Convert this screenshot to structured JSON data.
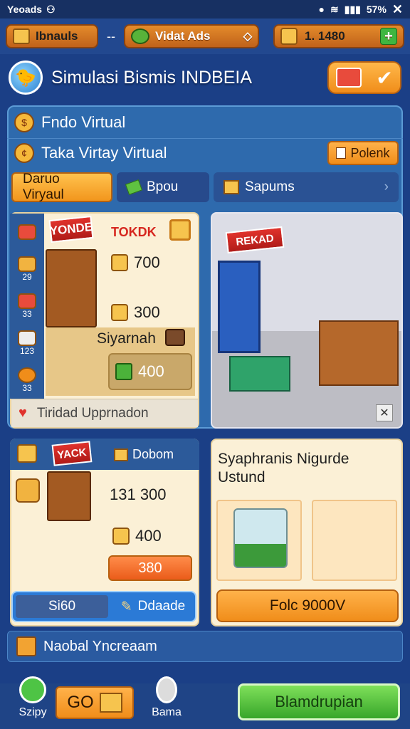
{
  "status": {
    "left_text": "Yeoads",
    "battery": "57%"
  },
  "resources": {
    "item1": "Ibnauls",
    "separator": "--",
    "item2": "Vidat Ads",
    "item3": "1. 1480"
  },
  "header": {
    "title": "Simulasi Bismis INDBEIA"
  },
  "panel": {
    "row1": "Fndo Virtual",
    "row2": "Taka Virtay Virtual",
    "row2_button": "Polenk",
    "tabs": [
      "Daruo Viryaul",
      "Bpou",
      "Sapums"
    ]
  },
  "shop_card": {
    "sign": "YONDE",
    "brand": "TOKDK",
    "value1": "700",
    "value2": "300",
    "subtitle": "Siyarnah",
    "value3": "400",
    "sidebar_counts": [
      "29",
      "33",
      "123",
      "33"
    ],
    "footer": "Tiridad Upprnadon"
  },
  "scene": {
    "banner": "REKAD"
  },
  "store_card": {
    "tag": "YACK",
    "header": "Dobom",
    "value1": "131 300",
    "value2": "400",
    "orange_value": "380",
    "left_button": "Si60",
    "right_button": "Ddaade"
  },
  "upgrade_card": {
    "title": "Syaphranis Nigurde Ustund",
    "button": "Folc 9000V"
  },
  "info_bar": {
    "text": "Naobal Yncreaam"
  },
  "bottom": {
    "nav1": "Szipy",
    "nav2": "GO",
    "nav3": "Bama",
    "action": "Blamdrupian"
  },
  "colors": {
    "accent": "#f08d1a",
    "primary": "#1b3f86",
    "green": "#37a62a"
  }
}
